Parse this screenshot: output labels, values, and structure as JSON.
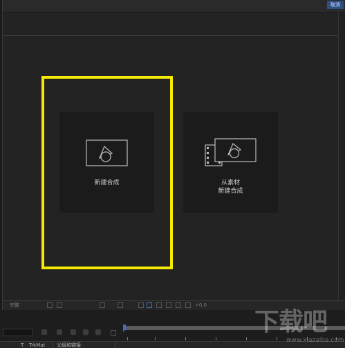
{
  "top_bar": {
    "accent_label": "取消"
  },
  "start_panel": {
    "new_composition": {
      "label": "新建合成"
    },
    "from_footage": {
      "label_line1": "从素材",
      "label_line2": "新建合成"
    },
    "highlight_color": "#f5ea00"
  },
  "bottom_toolbar": {
    "view_label": "完整",
    "value_label": "+0.0"
  },
  "timeline": {
    "columns": [
      "T",
      "TrkMat",
      "父级和链接"
    ]
  },
  "watermark": {
    "text": "下载吧",
    "url": "www.xiazaiba.com"
  },
  "colors": {
    "background": "#232323",
    "card": "#1b1b1b",
    "accent_blue": "#3d6fc4"
  }
}
